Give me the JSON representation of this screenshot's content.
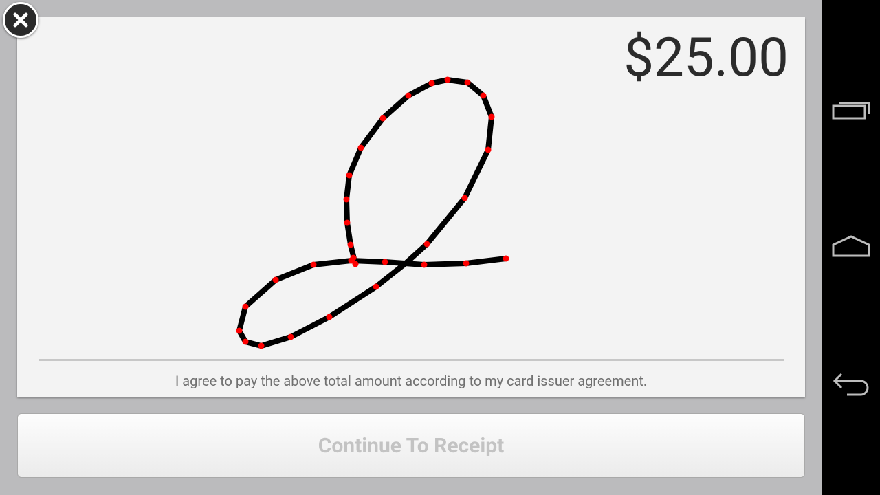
{
  "payment": {
    "amount": "$25.00",
    "agreement_text": "I agree to pay the above total amount according to my card issuer agreement."
  },
  "actions": {
    "continue_label": "Continue To Receipt"
  },
  "nav_bar": {
    "icons": [
      "recent-apps-icon",
      "home-icon",
      "back-icon"
    ]
  },
  "colors": {
    "signature_stroke": "#000000",
    "signature_points": "#ff0000",
    "card_background": "#f3f3f3",
    "page_background": "#bbbbbd"
  }
}
